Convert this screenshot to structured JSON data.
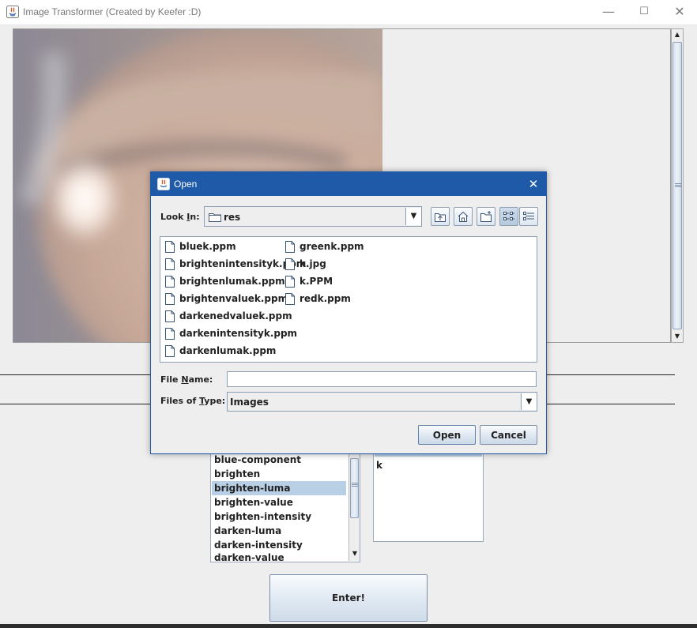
{
  "window": {
    "title": "Image Transformer (Created by Keefer :D)",
    "controls": {
      "minimize": "—",
      "maximize": "☐",
      "close": "✕"
    }
  },
  "operations": {
    "items": [
      "blue-component",
      "brighten",
      "brighten-luma",
      "brighten-value",
      "brighten-intensity",
      "darken-luma",
      "darken-intensity",
      "darken-value"
    ],
    "selected": "brighten-luma"
  },
  "loaded_images": {
    "items": [
      "k"
    ]
  },
  "enter_button": "Enter!",
  "dialog": {
    "title": "Open",
    "look_in_label": {
      "pre": "Look ",
      "key": "I",
      "post": "n:"
    },
    "look_in_value": "res",
    "toolbar": [
      "up-one-level-icon",
      "home-icon",
      "new-folder-icon",
      "list-view-icon",
      "details-view-icon"
    ],
    "files_col1": [
      "bluek.ppm",
      "brightenintensityk.ppm",
      "brightenlumak.ppm",
      "brightenvaluek.ppm",
      "darkenedvaluek.ppm",
      "darkenintensityk.ppm",
      "darkenlumak.ppm"
    ],
    "files_col2": [
      "greenk.ppm",
      "k.jpg",
      "k.PPM",
      "redk.ppm"
    ],
    "file_name_label": {
      "pre": "File ",
      "key": "N",
      "post": "ame:"
    },
    "file_name_value": "",
    "files_of_type_label": {
      "pre": "Files of ",
      "key": "T",
      "post": "ype:"
    },
    "files_of_type_value": "Images",
    "open_button": "Open",
    "cancel_button": "Cancel"
  },
  "colors": {
    "dialog_title_bg": "#1e5aa8",
    "selection": "#b8cfe5",
    "window_bg": "#eeeeee"
  }
}
